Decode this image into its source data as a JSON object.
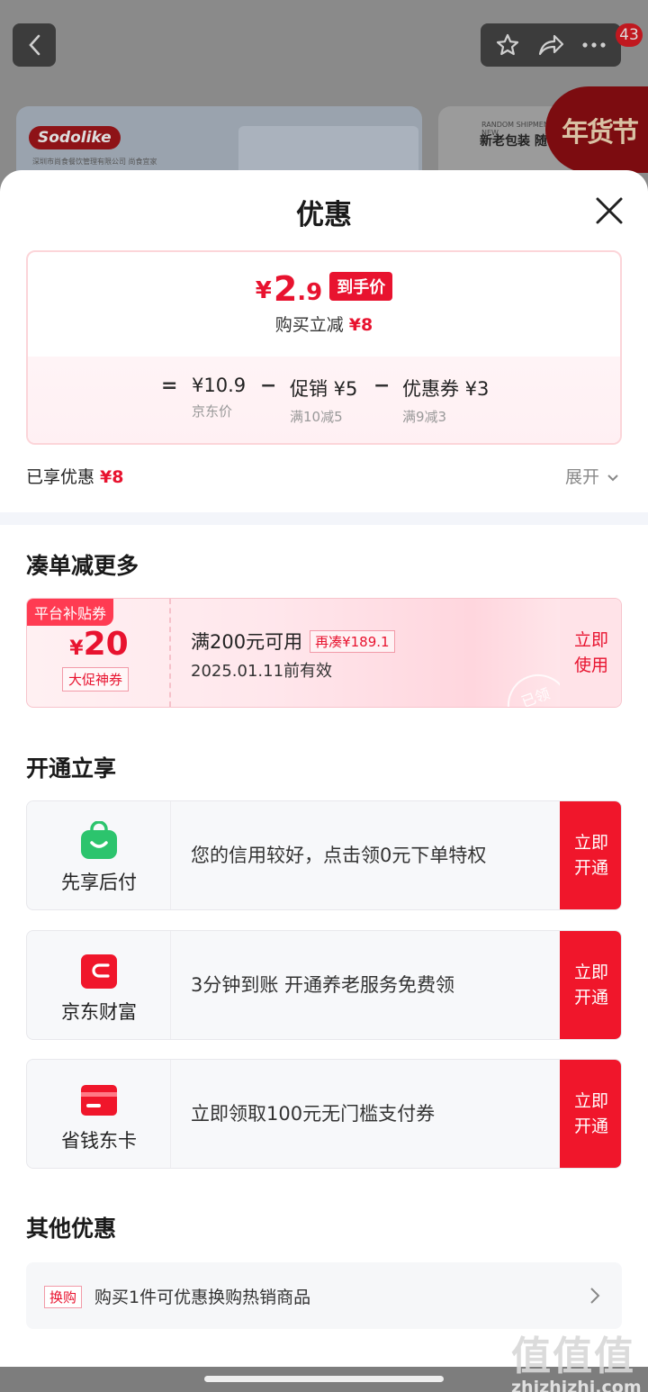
{
  "background": {
    "cart_badge": "43",
    "brand_logo": "Sodolike",
    "brand_sub": "深圳市尚食餐饮管理有限公司 尚食宜家",
    "card2_small": "RANDOM SHIPMENT OF NEW",
    "card2_text": "新老包装 随",
    "festival": "年货节"
  },
  "sheet": {
    "title": "优惠"
  },
  "price": {
    "currency": "¥",
    "final_int": "2",
    "final_dec": ".9",
    "final_tag": "到手价",
    "save_label": "购买立减",
    "save_amount": "¥8",
    "equals": "=",
    "minus": "−",
    "jd_price": "¥10.9",
    "jd_price_label": "京东价",
    "promo": "促销 ¥5",
    "promo_label": "满10减5",
    "coupon": "优惠券 ¥3",
    "coupon_label": "满9减3"
  },
  "summary": {
    "enjoyed_label": "已享优惠",
    "enjoyed_amount": "¥8",
    "expand_label": "展开"
  },
  "more_section": {
    "title": "凑单减更多",
    "coupon": {
      "badge": "平台补贴券",
      "currency": "¥",
      "amount": "20",
      "tag": "大促神券",
      "condition": "满200元可用",
      "more": "再凑¥189.1",
      "valid": "2025.01.11前有效",
      "stamp": "已领",
      "button": "立即使用"
    }
  },
  "open_section": {
    "title": "开通立享",
    "items": [
      {
        "name": "先享后付",
        "desc": "您的信用较好，点击领0元下单特权",
        "button": "立即开通",
        "icon": "shopping-bag-icon",
        "color": "#2cc46d"
      },
      {
        "name": "京东财富",
        "desc": "3分钟到账 开通养老服务免费领",
        "button": "立即开通",
        "icon": "wallet-icon",
        "color": "#f0162b"
      },
      {
        "name": "省钱东卡",
        "desc": "立即领取100元无门槛支付券",
        "button": "立即开通",
        "icon": "card-icon",
        "color": "#f0162b"
      }
    ]
  },
  "other_section": {
    "title": "其他优惠",
    "tag": "换购",
    "text": "购买1件可优惠换购热销商品"
  },
  "watermark": {
    "logo": "值值值",
    "site": "zhizhizhi.com"
  },
  "colors": {
    "accent": "#e8132f",
    "button_red": "#f0162b",
    "green": "#2cc46d"
  }
}
